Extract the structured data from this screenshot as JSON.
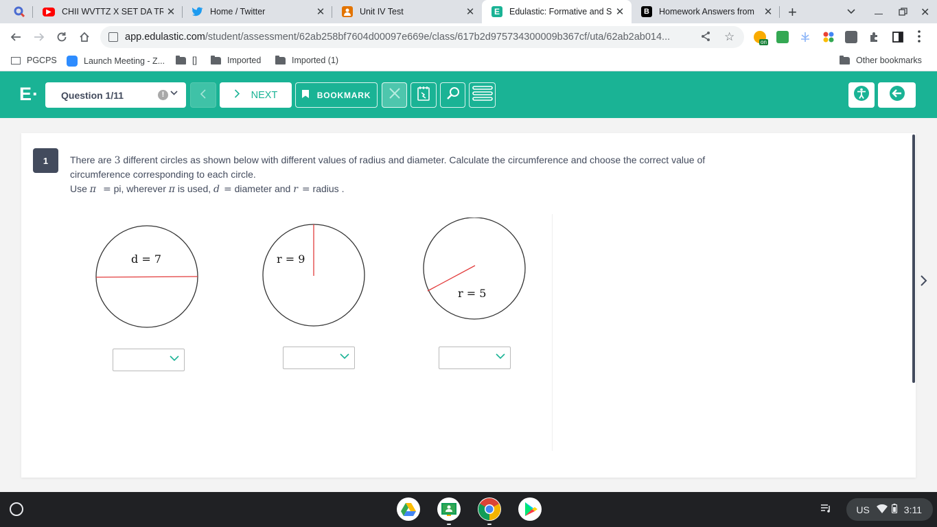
{
  "browser": {
    "tabs": [
      {
        "title": "",
        "favicon": "app-icon",
        "active": false
      },
      {
        "title": "CHII WVTTZ X SET DA TRE",
        "favicon": "youtube-icon",
        "active": false
      },
      {
        "title": "Home / Twitter",
        "favicon": "twitter-icon",
        "active": false
      },
      {
        "title": "Unit IV Test",
        "favicon": "classroom-icon",
        "active": false
      },
      {
        "title": "Edulastic: Formative and S",
        "favicon": "edulastic-icon",
        "active": true
      },
      {
        "title": "Homework Answers from",
        "favicon": "brainly-icon",
        "active": false
      }
    ],
    "url_host": "app.edulastic.com",
    "url_path": "/student/assessment/62ab258bf7604d00097e669e/class/617b2d975734300009b367cf/uta/62ab2ab014...",
    "bookmarks": [
      "PGCPS",
      "Launch Meeting - Z...",
      "[]",
      "Imported",
      "Imported (1)"
    ],
    "other_bookmarks": "Other bookmarks",
    "ext_badge": "on"
  },
  "header": {
    "logo": "E·",
    "question_label": "Question 1/11",
    "next_label": "NEXT",
    "bookmark_label": "BOOKMARK"
  },
  "question": {
    "number": "1",
    "line1_a": "There are ",
    "line1_num": "3",
    "line1_b": " different circles as shown below with different values of radius and diameter. Calculate the circumference and choose the correct value of",
    "line2": "circumference  corresponding to each circle.",
    "line3_use": "Use ",
    "pi": "π",
    "eq": "=",
    "line3_pi": " pi, wherever ",
    "line3_used": " is used, ",
    "d": "d",
    "line3_diam": " diameter and ",
    "r": "r",
    "line3_radius": " radius ."
  },
  "circles": [
    {
      "label": "d = 7"
    },
    {
      "label": "r = 9"
    },
    {
      "label": "r = 5"
    }
  ],
  "colors": {
    "brand": "#1ab395",
    "line": "#e23b3b",
    "text": "#434b5d"
  },
  "shelf": {
    "locale": "US",
    "time": "3:11"
  }
}
